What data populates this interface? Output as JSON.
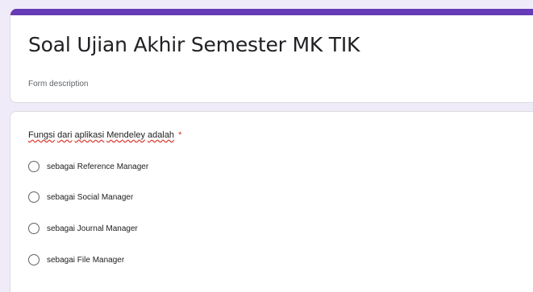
{
  "form": {
    "title": "Soal Ujian Akhir Semester MK TIK",
    "description": "Form description"
  },
  "question": {
    "text_words": [
      "Fungsi",
      "dari",
      "aplikasi",
      "Mendeley",
      "adalah"
    ],
    "required_marker": "*",
    "options": [
      "sebagai Reference Manager",
      "sebagai Social Manager",
      "sebagai Journal Manager",
      "sebagai File Manager"
    ]
  },
  "colors": {
    "accent": "#673ab7",
    "background": "#f0ebf8",
    "required": "#d93025"
  }
}
